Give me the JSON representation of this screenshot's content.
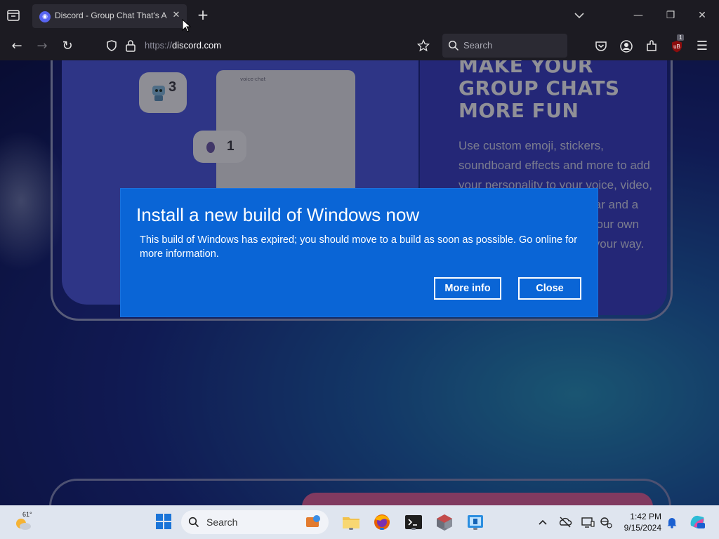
{
  "browser": {
    "tab": {
      "title": "Discord - Group Chat That's All Fun & Games"
    },
    "url": {
      "prefix": "https://",
      "domain": "discord.com"
    },
    "search_placeholder": "Search",
    "extension_badge": "1"
  },
  "page": {
    "heading_lines": [
      "MAKE YOUR",
      "GROUP CHATS",
      "MORE FUN"
    ],
    "blurb": "Use custom emoji, stickers, soundboard effects and more to add your personality to your voice, video, or text chat. Set your avatar and a custom status, and write your own profile to show up in chat your way.",
    "mock_window_title": "voice-chat",
    "bubble_count_1": "3",
    "bubble_count_2": "1"
  },
  "dialog": {
    "title": "Install a new build of Windows now",
    "message": "This build of Windows has expired; you should move to a build as soon as possible. Go online for more information.",
    "more_info_label": "More info",
    "close_label": "Close"
  },
  "taskbar": {
    "weather_temp": "61°",
    "search_placeholder": "Search",
    "time": "1:42 PM",
    "date": "9/15/2024"
  },
  "colors": {
    "dialog_bg": "#0a65d6",
    "taskbar_bg": "#dfe5ef",
    "browser_chrome": "#1c1b22",
    "discord_blurple": "#5865f2"
  }
}
